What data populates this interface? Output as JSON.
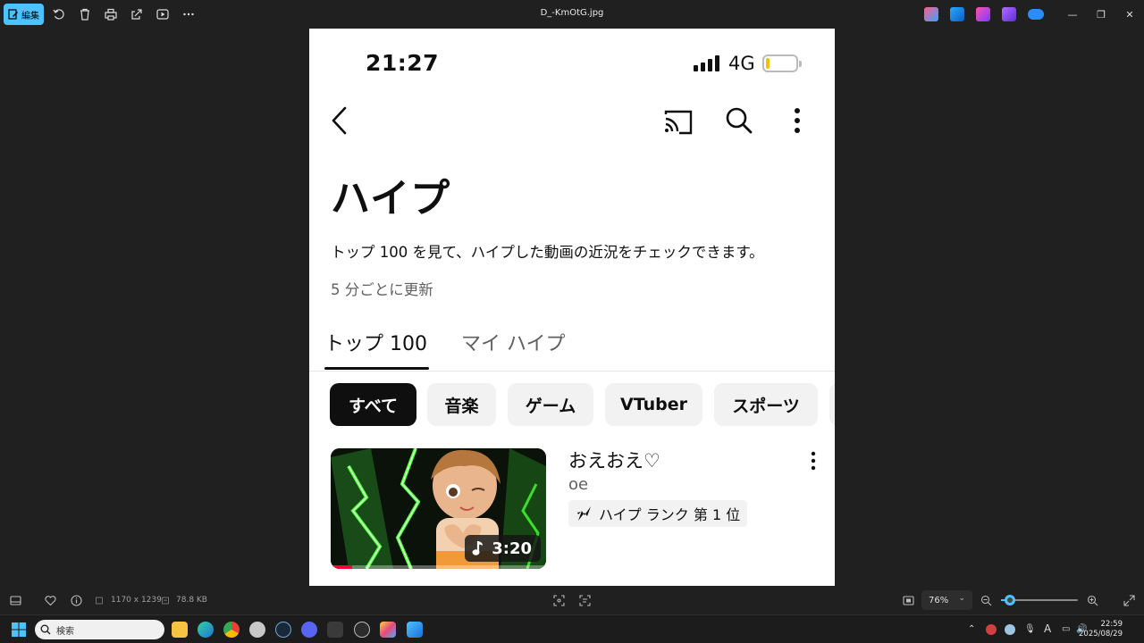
{
  "viewer": {
    "edit_label": "編集",
    "file_name": "D_-KmOtG.jpg",
    "image_dimensions": "1170 x 1239",
    "file_size": "78.8 KB",
    "zoom_level": "76%",
    "zoom_fraction": 0.12
  },
  "phone": {
    "status_time": "21:27",
    "network": "4G",
    "battery_level": 0.12,
    "page_title": "ハイプ",
    "description": "トップ 100 を見て、ハイプした動画の近況をチェックできます。",
    "update_note": "5 分ごとに更新",
    "tabs": [
      {
        "label": "トップ 100",
        "active": true
      },
      {
        "label": "マイ ハイプ",
        "active": false
      }
    ],
    "chips": [
      {
        "label": "すべて",
        "selected": true
      },
      {
        "label": "音楽",
        "selected": false
      },
      {
        "label": "ゲーム",
        "selected": false
      },
      {
        "label": "VTuber",
        "selected": false
      },
      {
        "label": "スポーツ",
        "selected": false
      }
    ],
    "video": {
      "title": "おえおえ♡",
      "channel": "oe",
      "rank_label": "ハイプ ランク 第 1 位",
      "duration": "3:20",
      "watched_fraction": 0.1
    }
  },
  "taskbar": {
    "search_placeholder": "検索",
    "time": "22:59",
    "date": "2025/08/29"
  },
  "colors": {
    "accent": "#4cc2ff",
    "youtube_red": "#ff0033",
    "battery_low": "#f2c200"
  }
}
